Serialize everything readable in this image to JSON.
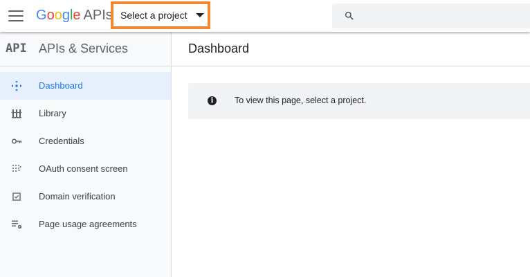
{
  "header": {
    "logo_letters": [
      "G",
      "o",
      "o",
      "g",
      "l",
      "e"
    ],
    "logo_product": "APIs",
    "project_picker_label": "Select a project",
    "search_placeholder": "",
    "accent_colors": {
      "highlight_border": "#F5872C",
      "blue": "#4285F4",
      "red": "#EA4335",
      "yellow": "#FBBC05",
      "green": "#34A853"
    }
  },
  "sidebar": {
    "badge": "API",
    "title": "APIs & Services",
    "items": [
      {
        "label": "Dashboard",
        "icon": "dashboard-icon",
        "active": true
      },
      {
        "label": "Library",
        "icon": "library-icon",
        "active": false
      },
      {
        "label": "Credentials",
        "icon": "key-icon",
        "active": false
      },
      {
        "label": "OAuth consent screen",
        "icon": "oauth-consent-icon",
        "active": false
      },
      {
        "label": "Domain verification",
        "icon": "checkbox-icon",
        "active": false
      },
      {
        "label": "Page usage agreements",
        "icon": "settings-list-icon",
        "active": false
      }
    ]
  },
  "main": {
    "title": "Dashboard",
    "notice_text": "To view this page, select a project."
  }
}
